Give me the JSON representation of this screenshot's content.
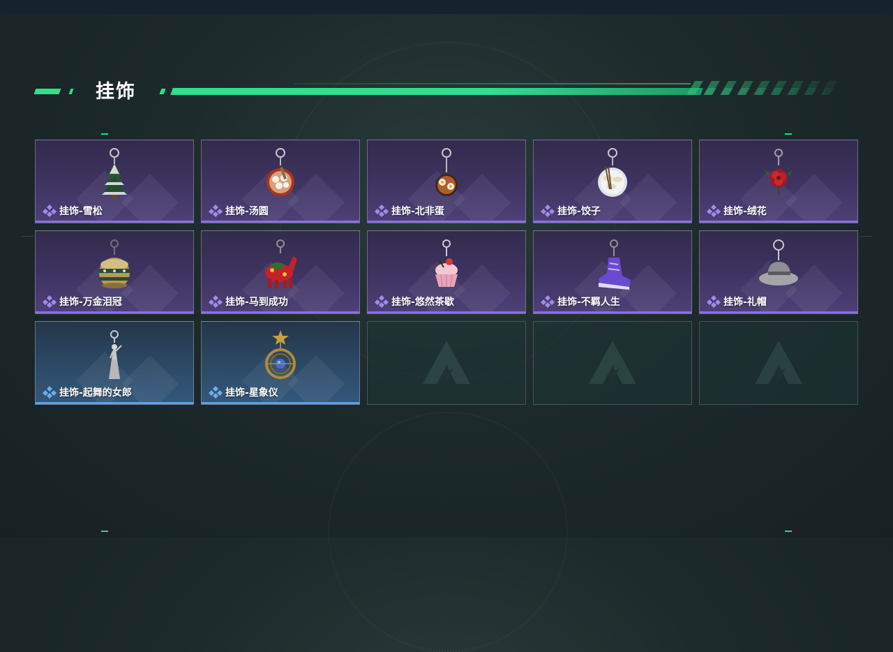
{
  "section": {
    "title": "挂饰"
  },
  "colors": {
    "accent": "#2fe08e",
    "rarity_purple": "#8a6fe0",
    "rarity_blue": "#5aa3e8"
  },
  "items": [
    {
      "label": "挂饰-雪松",
      "rarity": "purple",
      "icon": "pine-tree-charm-icon"
    },
    {
      "label": "挂饰-汤圆",
      "rarity": "purple",
      "icon": "tangyuan-bowl-charm-icon"
    },
    {
      "label": "挂饰-北非蛋",
      "rarity": "purple",
      "icon": "shakshuka-pan-charm-icon"
    },
    {
      "label": "挂饰-饺子",
      "rarity": "purple",
      "icon": "dumpling-plate-charm-icon"
    },
    {
      "label": "挂饰-绒花",
      "rarity": "purple",
      "icon": "velvet-flower-charm-icon"
    },
    {
      "label": "挂饰-万金泪冠",
      "rarity": "purple",
      "icon": "golden-crown-charm-icon"
    },
    {
      "label": "挂饰-马到成功",
      "rarity": "purple",
      "icon": "red-horse-charm-icon"
    },
    {
      "label": "挂饰-悠然茶歇",
      "rarity": "purple",
      "icon": "cupcake-charm-icon"
    },
    {
      "label": "挂饰-不羁人生",
      "rarity": "purple",
      "icon": "sneaker-charm-icon"
    },
    {
      "label": "挂饰-礼帽",
      "rarity": "purple",
      "icon": "fedora-hat-charm-icon"
    },
    {
      "label": "挂饰-起舞的女郎",
      "rarity": "blue",
      "icon": "dancing-lady-charm-icon"
    },
    {
      "label": "挂饰-星象仪",
      "rarity": "blue",
      "icon": "astrolabe-charm-icon"
    }
  ],
  "empty_slots": 3
}
